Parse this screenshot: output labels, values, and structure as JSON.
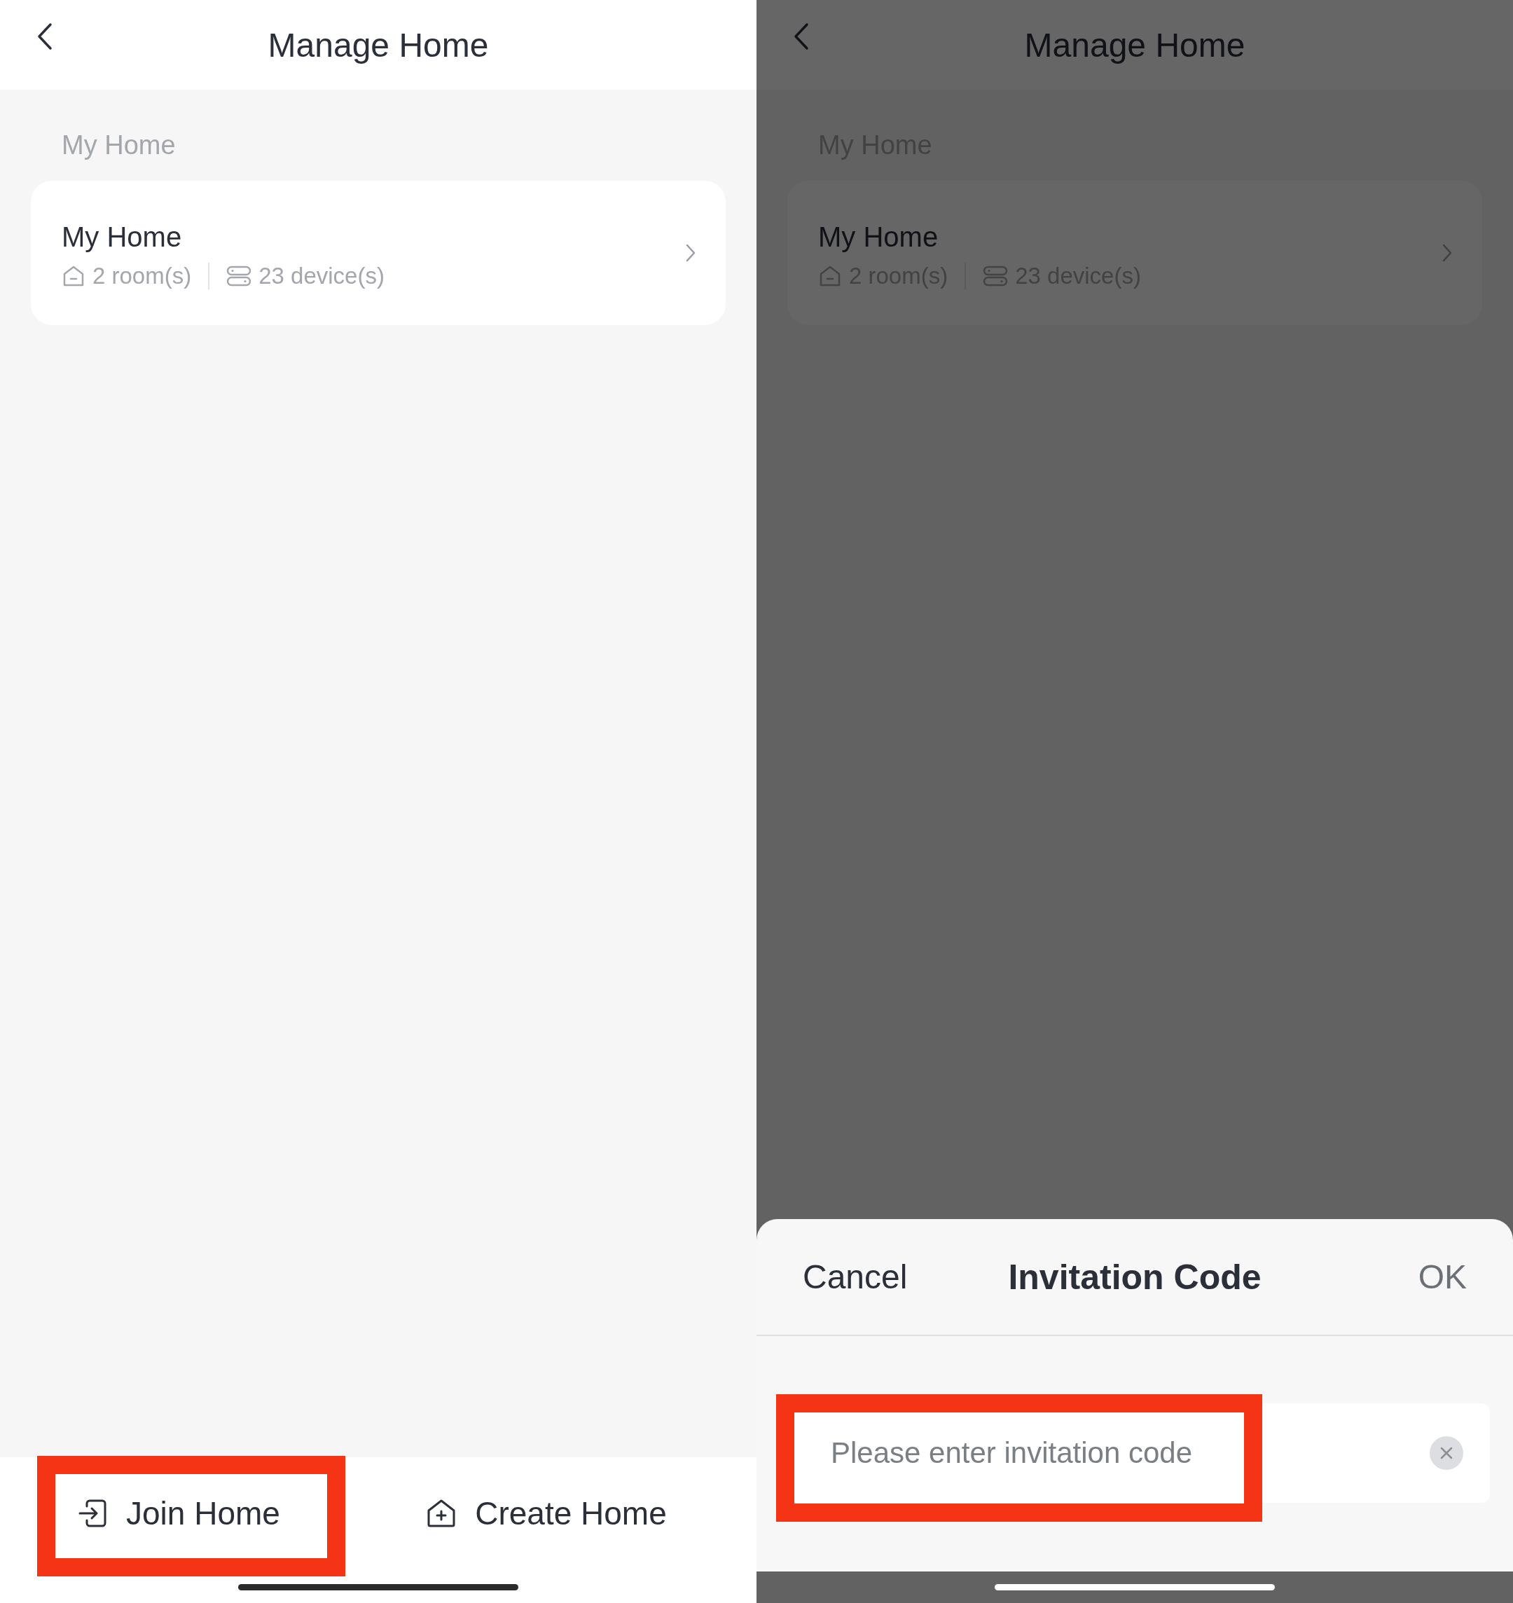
{
  "panels": [
    {
      "title": "Manage Home",
      "section_label": "My Home",
      "dimmed": false,
      "homes": [
        {
          "name": "My Home",
          "rooms": "2 room(s)",
          "devices": "23 device(s)"
        }
      ],
      "bottom_bar": {
        "buttons": [
          {
            "kind": "join",
            "label": "Join Home",
            "highlighted": true
          },
          {
            "kind": "create",
            "label": "Create Home",
            "highlighted": false
          }
        ]
      }
    },
    {
      "title": "Manage Home",
      "section_label": "My Home",
      "dimmed": true,
      "homes": [
        {
          "name": "My Home",
          "rooms": "2 room(s)",
          "devices": "23 device(s)"
        }
      ],
      "sheet": {
        "cancel": "Cancel",
        "title": "Invitation Code",
        "ok": "OK",
        "input": {
          "placeholder": "Please enter invitation code",
          "highlighted": true
        }
      }
    }
  ]
}
